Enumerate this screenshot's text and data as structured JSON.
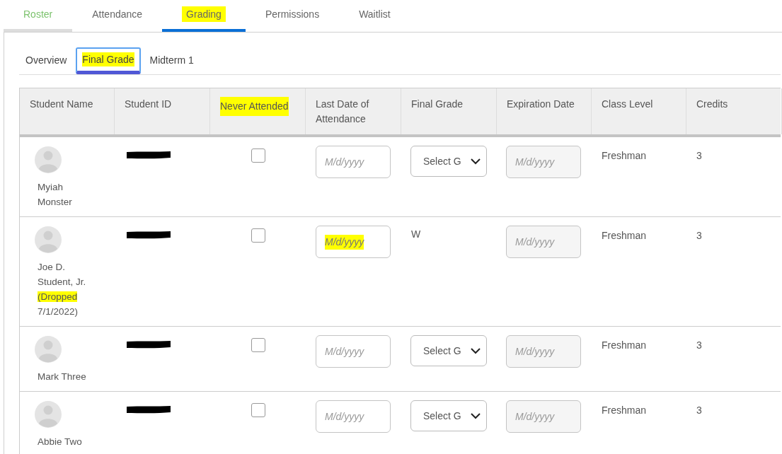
{
  "tabs": [
    {
      "label": "Roster",
      "selected": false,
      "visited": true,
      "highlighted": false
    },
    {
      "label": "Attendance",
      "selected": false,
      "visited": false,
      "highlighted": false
    },
    {
      "label": "Grading",
      "selected": true,
      "visited": false,
      "highlighted": true
    },
    {
      "label": "Permissions",
      "selected": false,
      "visited": false,
      "highlighted": false
    },
    {
      "label": "Waitlist",
      "selected": false,
      "visited": false,
      "highlighted": false
    }
  ],
  "subtabs": [
    {
      "label": "Overview",
      "selected": false,
      "highlighted": false
    },
    {
      "label": "Final Grade",
      "selected": true,
      "highlighted": true
    },
    {
      "label": "Midterm 1",
      "selected": false,
      "highlighted": false
    }
  ],
  "table": {
    "columns": [
      {
        "label": "Student Name",
        "highlighted": false
      },
      {
        "label": "Student ID",
        "highlighted": false
      },
      {
        "label": "Never Attended",
        "highlighted": true
      },
      {
        "label": "Last Date of Attendance",
        "highlighted": false
      },
      {
        "label": "Final Grade",
        "highlighted": false
      },
      {
        "label": "Expiration Date",
        "highlighted": false
      },
      {
        "label": "Class Level",
        "highlighted": false
      },
      {
        "label": "Credits",
        "highlighted": false
      }
    ],
    "rows": [
      {
        "name": "Myiah Monster",
        "notes": [],
        "id_redacted": true,
        "never_attended": false,
        "last_date": {
          "placeholder": "M/d/yyyy",
          "highlighted": false
        },
        "grade": {
          "kind": "select",
          "value": "Select G"
        },
        "expiration": {
          "placeholder": "M/d/yyyy",
          "disabled": true
        },
        "class_level": "Freshman",
        "credits": "3"
      },
      {
        "name": "Joe D. Student, Jr.",
        "notes": [
          {
            "text": "(Dropped",
            "highlighted": true
          },
          {
            "text": "7/1/2022)",
            "highlighted": false
          }
        ],
        "id_redacted": true,
        "never_attended": false,
        "last_date": {
          "placeholder": "M/d/yyyy",
          "highlighted": true
        },
        "grade": {
          "kind": "text",
          "value": "W"
        },
        "expiration": {
          "placeholder": "M/d/yyyy",
          "disabled": true
        },
        "class_level": "Freshman",
        "credits": "3"
      },
      {
        "name": "Mark Three",
        "notes": [],
        "id_redacted": true,
        "never_attended": false,
        "last_date": {
          "placeholder": "M/d/yyyy",
          "highlighted": false
        },
        "grade": {
          "kind": "select",
          "value": "Select G"
        },
        "expiration": {
          "placeholder": "M/d/yyyy",
          "disabled": true
        },
        "class_level": "Freshman",
        "credits": "3"
      },
      {
        "name": "Abbie Two",
        "notes": [],
        "id_redacted": true,
        "never_attended": false,
        "last_date": {
          "placeholder": "M/d/yyyy",
          "highlighted": false
        },
        "grade": {
          "kind": "select",
          "value": "Select G"
        },
        "expiration": {
          "placeholder": "M/d/yyyy",
          "disabled": true
        },
        "class_level": "Freshman",
        "credits": "3"
      }
    ]
  }
}
